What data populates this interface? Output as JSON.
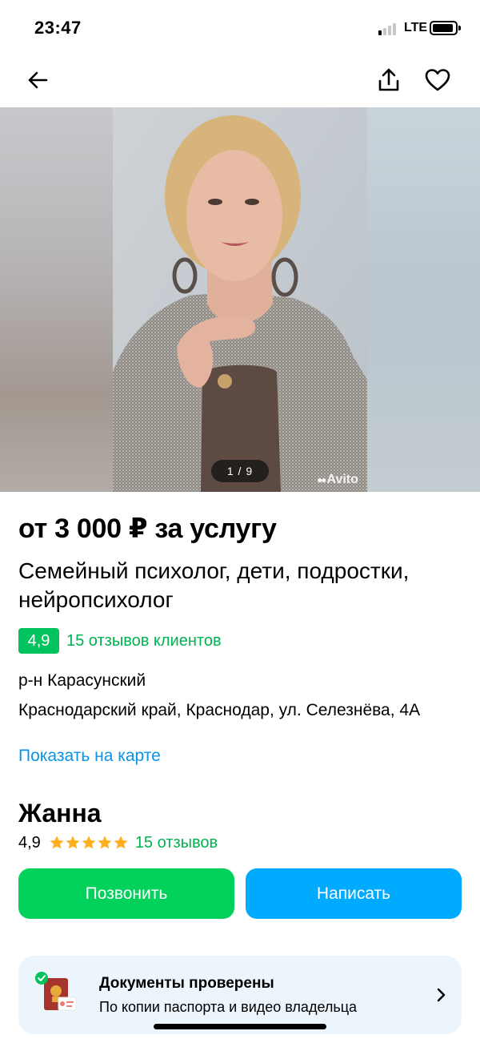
{
  "status_bar": {
    "time": "23:47",
    "network": "LTE",
    "signal_bars_active": 1
  },
  "nav": {
    "back_icon": "arrow-left-icon",
    "share_icon": "share-icon",
    "favorite_icon": "heart-icon"
  },
  "gallery": {
    "counter": "1 / 9",
    "watermark": "Avito"
  },
  "listing": {
    "price": "от 3 000 ₽ за услугу",
    "title": "Семейный психолог, дети, подростки, нейропсихолог",
    "rating": "4,9",
    "reviews_link": "15 отзывов клиентов",
    "district": "р-н Карасунский",
    "address": "Краснодарский край, Краснодар, ул. Селезнёва, 4А",
    "map_link": "Показать на карте"
  },
  "seller": {
    "name": "Жанна",
    "rating": "4,9",
    "stars": 5,
    "reviews": "15 отзывов"
  },
  "actions": {
    "call_label": "Позвонить",
    "write_label": "Написать"
  },
  "documents": {
    "title": "Документы проверены",
    "subtitle": "По копии паспорта и видео владельца"
  },
  "colors": {
    "green": "#02d15c",
    "blue": "#00aaff",
    "link_blue": "#0a93e5",
    "star": "#ffb021"
  }
}
